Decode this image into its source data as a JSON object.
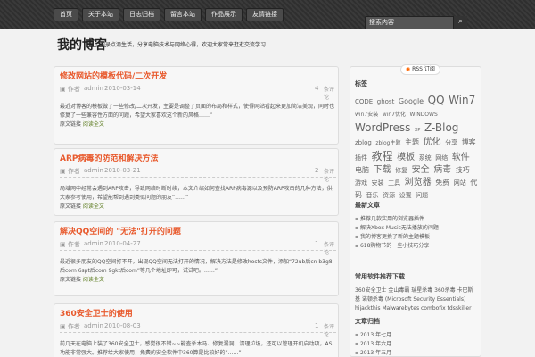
{
  "nav": [
    "首页",
    "关于本站",
    "日志归档",
    "留言本站",
    "作品展示",
    "友情链接"
  ],
  "search_placeholder": "搜索内容",
  "site_title": "我的博客",
  "site_desc": "记录点滴生活，分享电脑技术与网络心得，欢迎大家常来逛逛交流学习",
  "posts": [
    {
      "title": "修改网站的模板代码/二次开发",
      "author": "admin",
      "date": "2010-03-14",
      "comments": "4",
      "comments_label": "条评论",
      "excerpt": "最近对博客的模板做了一些修改/二次开发，主要是调整了页面的布局和样式，使得网站看起来更加简洁美观，同时也修复了一些兼容性方面的问题，希望大家喜欢这个新的风格……”",
      "read": "阅读全文"
    },
    {
      "title": "ARP病毒的防范和解决方法",
      "author": "admin",
      "date": "2010-03-21",
      "comments": "2",
      "comments_label": "条评论",
      "excerpt": "局域网中经常会遇到ARP攻击，导致网络时断时续，本文介绍如何查找ARP病毒源以及预防ARP攻击的几种方法，供大家参考使用，希望能帮到遇到类似问题的朋友”……”",
      "read": "阅读全文"
    },
    {
      "title": "解决QQ空间的 \"无法\"打开的问题",
      "author": "admin",
      "date": "2010-04-27",
      "comments": "1",
      "comments_label": "条评论",
      "excerpt": "最近很多朋友的QQ空间打不开，出现QQ空间无法打开的情况，解决方法是修改hosts文件，添加“72ub后cn b3g8后com 6spt后com 9gkt后com”等几个地址即可，试试吧。……”",
      "read": "阅读全文"
    },
    {
      "title": "360安全卫士的使用",
      "author": "admin",
      "date": "2010-08-03",
      "comments": "1",
      "comments_label": "条评论",
      "excerpt": "前几天在电脑上装了360安全卫士，感觉很不错~~能查杀木马、修复漏洞、清理垃圾，还可以管理开机启动项，AS功能非常强大。推荐给大家使用，免费的安全软件中360算是比较好的”……”",
      "read": "阅读全文"
    }
  ],
  "sidebar": {
    "rss": "RSS 订阅",
    "tags_title": "标签",
    "tags": [
      "CODE",
      "ghost",
      "Google",
      "QQ",
      "Win7",
      "win7安装",
      "win7优化",
      "WINDOWS",
      "WordPress",
      "XP",
      "Z-Blog",
      "zblog",
      "zblog主题",
      "主题",
      "优化",
      "分享",
      "博客",
      "插件",
      "教程",
      "模板",
      "系统",
      "网络",
      "软件",
      "电脑",
      "下载",
      "修复",
      "安全",
      "病毒",
      "技巧",
      "游戏",
      "安装",
      "工具",
      "浏览器",
      "免费",
      "网站",
      "代码",
      "音乐",
      "资源",
      "设置",
      "问题"
    ],
    "recent_title": "最新文章",
    "recent": [
      "推荐几款实用的浏览器插件",
      "解决Xbox Music无法播放的问题",
      "我的博客更换了新的主题模板",
      "618购物节的一些小技巧分享"
    ],
    "soft_title": "常用软件推荐下载",
    "soft": "360安全卫士 金山毒霸 瑞星杀毒 360杀毒 卡巴斯基 诺顿杀毒 (Microsoft Security Essentials) hijackthis Malwarebytes combofix tdsskiller",
    "archive_title": "文章归档",
    "archive": [
      "2013 年七月",
      "2013 年六月",
      "2013 年五月"
    ]
  }
}
